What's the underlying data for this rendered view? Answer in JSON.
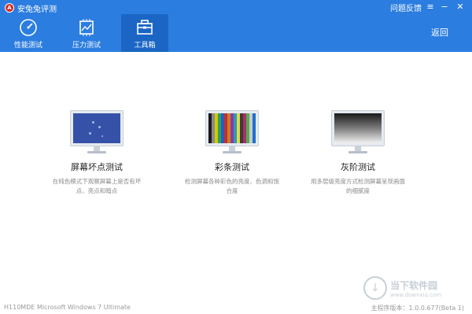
{
  "window": {
    "title": "安兔兔评测",
    "feedback": "问题反馈",
    "menu_icon": "≡",
    "minimize_icon": "−",
    "close_icon": "✕"
  },
  "tabs": [
    {
      "label": "性能测试",
      "icon": "speedometer-icon"
    },
    {
      "label": "压力测试",
      "icon": "cpu-chart-icon"
    },
    {
      "label": "工具箱",
      "icon": "toolbox-icon",
      "active": true
    }
  ],
  "back_label": "返回",
  "tools": [
    {
      "title": "屏幕坏点测试",
      "desc": "在纯色模式下观察屏幕上是否有坏点、亮点和暗点"
    },
    {
      "title": "彩条测试",
      "desc": "检测屏幕各种彩色的亮度、色调和饱合度"
    },
    {
      "title": "灰阶测试",
      "desc": "用多层级亮度方式检测屏幕呈现画面的细腻度"
    }
  ],
  "color_bars": [
    "#1a1a1a",
    "#8a8a8a",
    "#d6c800",
    "#25a35a",
    "#3058c8",
    "#c03030",
    "#d07a1e",
    "#8a3aa8",
    "#2a9bb0",
    "#e0d84a",
    "#3b3b3b",
    "#b02a6a",
    "#4fb04f",
    "#c9c9c9",
    "#1e6fd0"
  ],
  "colors": {
    "topbar": "#2b7de0",
    "active_tab": "#1b66c4"
  },
  "footer": {
    "system": "H110MDE   Microsoft Windows 7 Ultimate",
    "version": "主程序版本：1.0.0.677(Beta 1)"
  },
  "watermark": {
    "name": "当下软件园",
    "url": "www.downxia.com"
  }
}
